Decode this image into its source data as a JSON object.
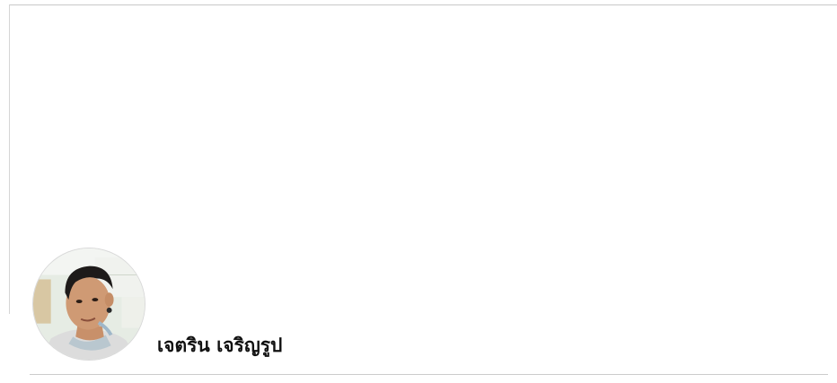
{
  "profile": {
    "name": "เจตริน เจริญรูป",
    "avatar_icon": "user-photo-avatar"
  },
  "colors": {
    "background": "#ffffff",
    "divider": "#cccccc",
    "name_text": "#111111"
  }
}
